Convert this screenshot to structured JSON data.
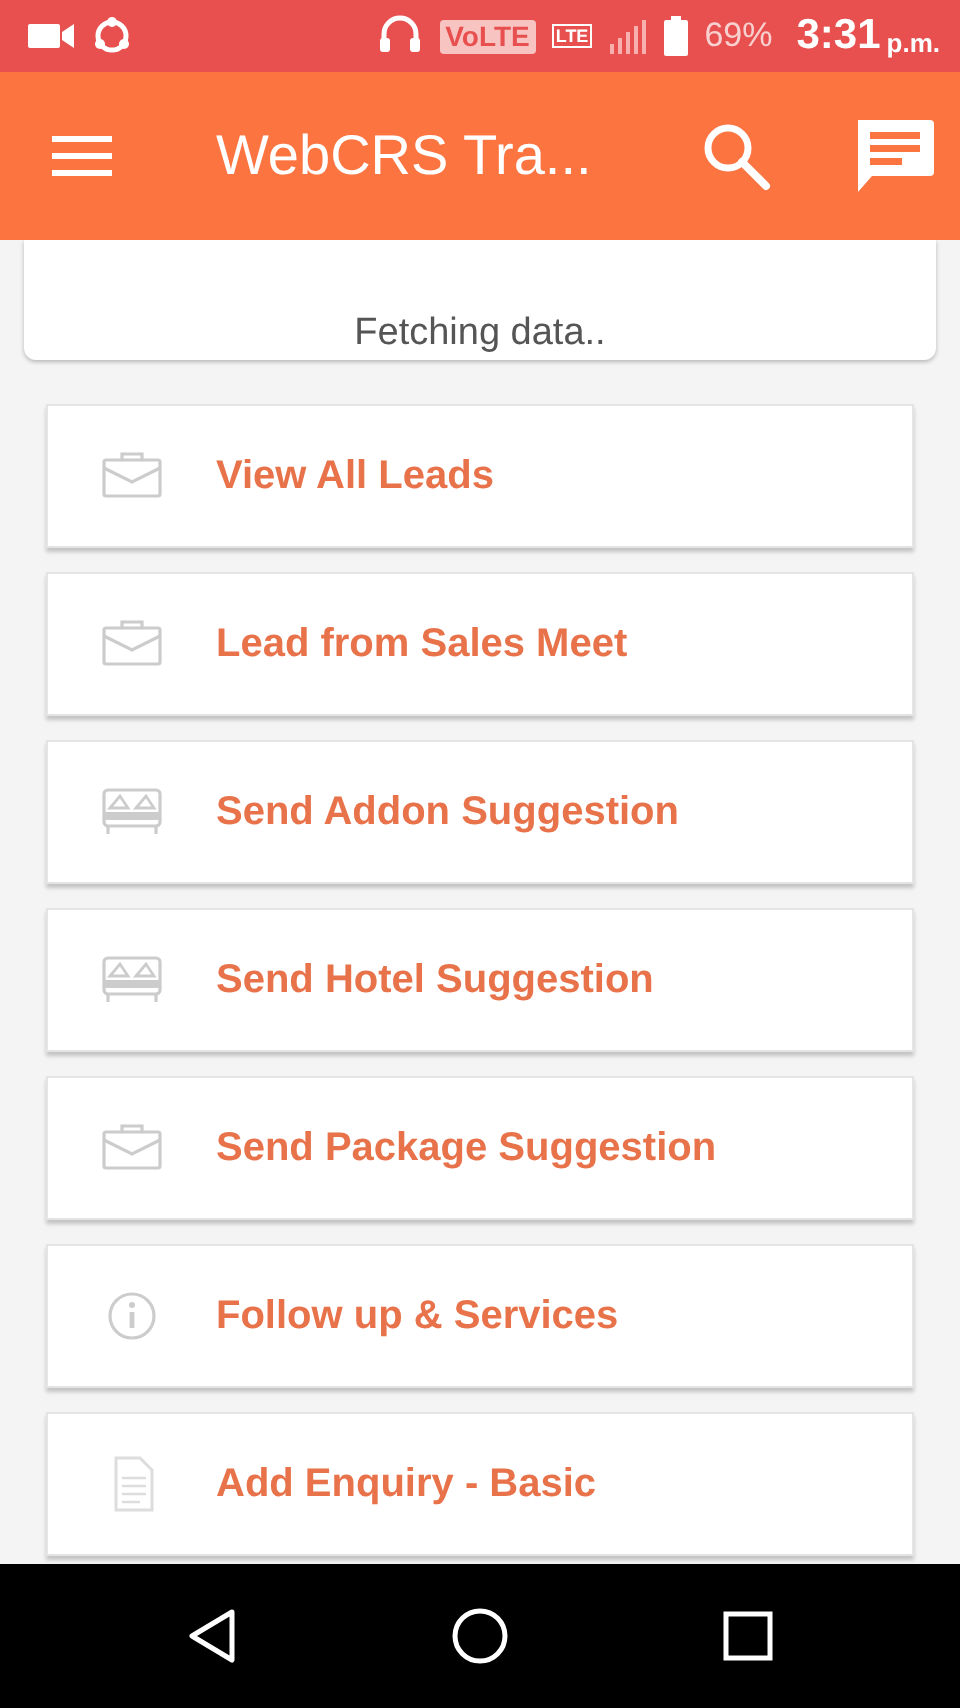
{
  "status_bar": {
    "volte": "VoLTE",
    "network": "LTE",
    "battery": "69%",
    "time": "3:31",
    "period": "p.m."
  },
  "toolbar": {
    "title": "WebCRS Tra..."
  },
  "loading_card": {
    "text": "Fetching data.."
  },
  "menu_items": [
    {
      "kind": "briefcase",
      "label": "View All Leads"
    },
    {
      "kind": "briefcase",
      "label": "Lead from Sales Meet"
    },
    {
      "kind": "bed",
      "label": "Send Addon Suggestion"
    },
    {
      "kind": "bed",
      "label": "Send Hotel Suggestion"
    },
    {
      "kind": "briefcase",
      "label": "Send Package Suggestion"
    },
    {
      "kind": "info",
      "label": "Follow up & Services"
    },
    {
      "kind": "document",
      "label": "Add Enquiry - Basic"
    }
  ]
}
